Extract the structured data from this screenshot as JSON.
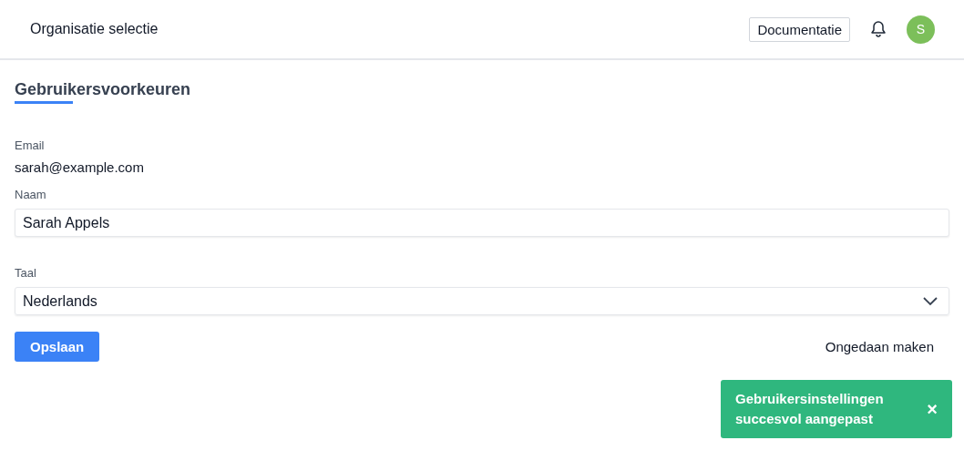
{
  "header": {
    "organization": "Organisatie selectie",
    "docs_button": "Documentatie",
    "avatar_initial": "S"
  },
  "page_title": "Gebruikersvoorkeuren",
  "email": {
    "label": "Email",
    "value": "sarah@example.com"
  },
  "name_field": {
    "label": "Naam",
    "value": "Sarah Appels"
  },
  "language_field": {
    "label": "Taal",
    "value": "Nederlands"
  },
  "save_button": "Opslaan",
  "undo_link": "Ongedaan maken",
  "toast": {
    "message": "Gebruikersinstellingen succesvol aangepast",
    "close": "×"
  }
}
